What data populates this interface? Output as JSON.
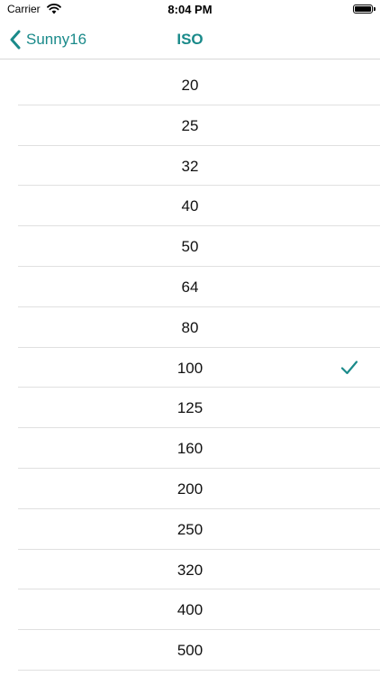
{
  "status_bar": {
    "carrier": "Carrier",
    "time": "8:04 PM",
    "wifi_icon": "wifi-icon",
    "battery_icon": "battery-icon",
    "battery_level": 1.0
  },
  "nav": {
    "back_label": "Sunny16",
    "back_icon": "chevron-left-icon",
    "title": "ISO",
    "accent_color": "#1a8a8a"
  },
  "iso_list": {
    "items": [
      {
        "label": "20",
        "selected": false
      },
      {
        "label": "25",
        "selected": false
      },
      {
        "label": "32",
        "selected": false
      },
      {
        "label": "40",
        "selected": false
      },
      {
        "label": "50",
        "selected": false
      },
      {
        "label": "64",
        "selected": false
      },
      {
        "label": "80",
        "selected": false
      },
      {
        "label": "100",
        "selected": true
      },
      {
        "label": "125",
        "selected": false
      },
      {
        "label": "160",
        "selected": false
      },
      {
        "label": "200",
        "selected": false
      },
      {
        "label": "250",
        "selected": false
      },
      {
        "label": "320",
        "selected": false
      },
      {
        "label": "400",
        "selected": false
      },
      {
        "label": "500",
        "selected": false
      }
    ],
    "selected_icon": "checkmark-icon"
  }
}
